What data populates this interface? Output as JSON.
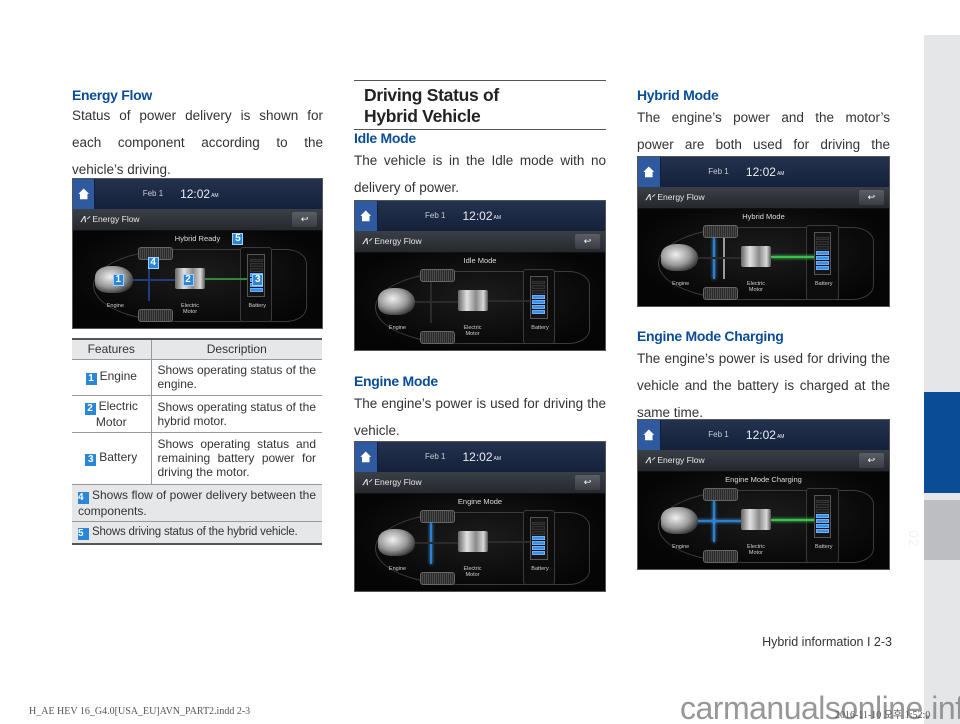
{
  "left_column": {
    "heading": "Energy Flow",
    "paragraph": "Status of power delivery is shown for each component according to the vehicle’s driving.",
    "screen": {
      "date": "Feb  1",
      "time": "12:02",
      "ampm": "AM",
      "bar_title": "Energy Flow",
      "status": "Hybrid Ready",
      "labels": {
        "engine": "Engine",
        "motor": "Electric Motor",
        "battery": "Battery"
      },
      "badges": [
        "1",
        "2",
        "3",
        "4",
        "5"
      ]
    },
    "table": {
      "headers": [
        "Features",
        "Description"
      ],
      "rows": [
        {
          "num": "1",
          "feature": "Engine",
          "description": "Shows operating status of the engine."
        },
        {
          "num": "2",
          "feature": "Electric Motor",
          "description": "Shows operating status of the hybrid motor."
        },
        {
          "num": "3",
          "feature": "Battery",
          "description": "Shows operating status and remaining battery power for driving the motor."
        }
      ],
      "full_rows": [
        {
          "num": "4",
          "text": "Shows flow of power delivery between the components."
        },
        {
          "num": "5",
          "text": "Shows driving status of the hybrid vehicle."
        }
      ]
    }
  },
  "middle_column": {
    "section_title_line1": "Driving Status of",
    "section_title_line2": "Hybrid Vehicle",
    "idle": {
      "heading": "Idle Mode",
      "paragraph": "The vehicle is in the Idle mode with no delivery of power.",
      "screen_status": "Idle Mode"
    },
    "engine": {
      "heading": "Engine Mode",
      "paragraph": "The engine’s power is used for driving the vehicle.",
      "screen_status": "Engine Mode"
    }
  },
  "right_column": {
    "hybrid": {
      "heading": "Hybrid Mode",
      "paragraph": "The engine’s power and the motor’s power are both used for driving the vehicle.",
      "screen_status": "Hybrid Mode"
    },
    "charging": {
      "heading": "Engine Mode Charging",
      "paragraph": "The engine’s power is used for driving the vehicle and the battery is charged at the same time.",
      "screen_status": "Engine Mode Charging"
    }
  },
  "side_tab": {
    "chapter": "02",
    "accent_color": "#0a4d96",
    "gray_color": "#e5e6e8"
  },
  "footer": {
    "page_label": "Hybrid information I 2-3",
    "print_info": "H_AE HEV 16_G4.0[USA_EU]AVN_PART2.indd   2-3",
    "print_date": "2016-11-10  오후 1:52:0",
    "watermark": "carmanualsonline.info"
  },
  "screen_common": {
    "date": "Feb  1",
    "time": "12:02",
    "ampm": "AM",
    "bar_title": "Energy Flow",
    "engine_label": "Engine",
    "motor_label_1": "Electric",
    "motor_label_2": "Motor",
    "battery_label": "Battery"
  }
}
